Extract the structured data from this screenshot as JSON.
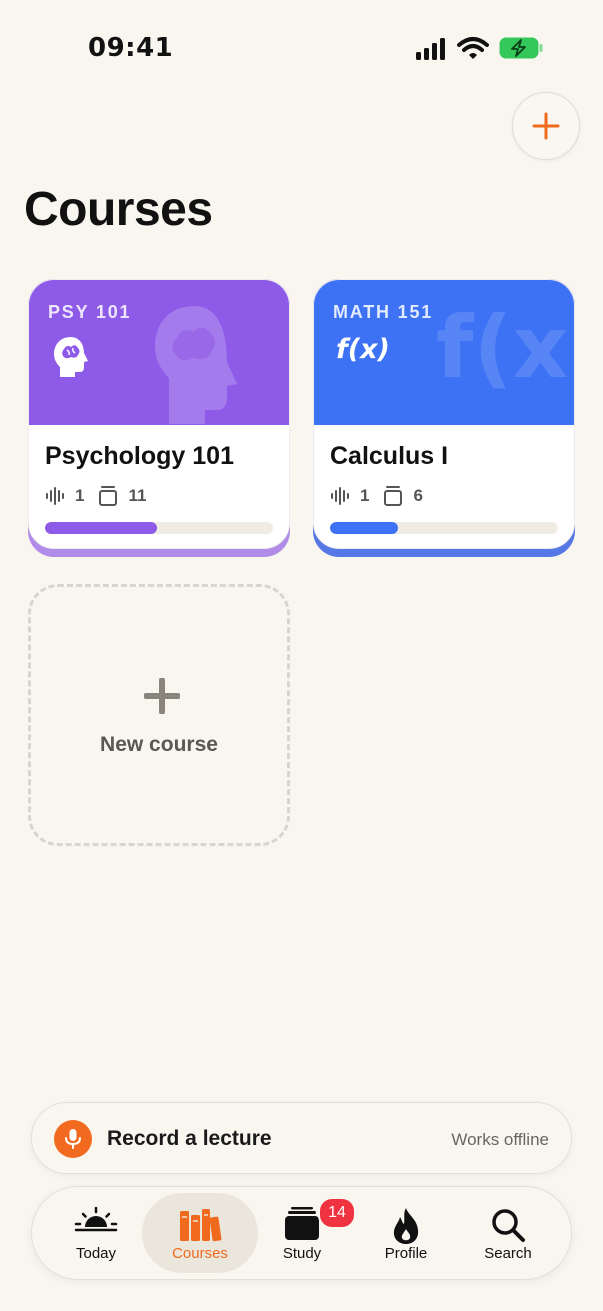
{
  "status_bar": {
    "time": "09:41"
  },
  "header": {
    "title": "Courses",
    "add_icon": "plus-icon"
  },
  "courses": [
    {
      "code": "PSY 101",
      "name": "Psychology 101",
      "icon": "brain-head-icon",
      "recordings": "1",
      "cards": "11",
      "progress": 0.49,
      "color": "#8e5ae8",
      "progress_color": "#8e5ae8"
    },
    {
      "code": "MATH 151",
      "name": "Calculus I",
      "icon": "function-icon",
      "icon_text": "f(x)",
      "recordings": "1",
      "cards": "6",
      "progress": 0.3,
      "color": "#3d72f5",
      "progress_color": "#3d72f5"
    }
  ],
  "new_course": {
    "label": "New course"
  },
  "record": {
    "label": "Record a lecture",
    "hint": "Works offline",
    "icon": "microphone-icon"
  },
  "tabs": [
    {
      "label": "Today",
      "icon": "sunrise-icon",
      "active": false
    },
    {
      "label": "Courses",
      "icon": "books-icon",
      "active": true
    },
    {
      "label": "Study",
      "icon": "cards-stack-icon",
      "active": false,
      "badge": "14"
    },
    {
      "label": "Profile",
      "icon": "flame-icon",
      "active": false
    },
    {
      "label": "Search",
      "icon": "search-icon",
      "active": false
    }
  ],
  "colors": {
    "accent": "#f06a1d",
    "background": "#f9f6f0",
    "badge": "#ef3340"
  }
}
